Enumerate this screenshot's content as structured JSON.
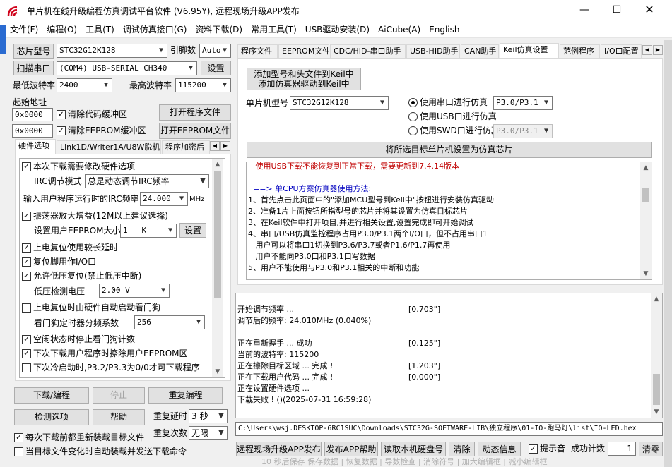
{
  "window": {
    "title": "单片机在线升级编程仿真调试平台软件 (V6.95Y), 远程现场升级APP发布"
  },
  "menu": [
    "文件(F)",
    "编程(O)",
    "工具(T)",
    "调试仿真接口(G)",
    "资料下载(D)",
    "常用工具(T)",
    "USB驱动安装(D)",
    "AiCube(A)",
    "English"
  ],
  "left": {
    "chip_btn": "芯片型号",
    "chip_value": "STC32G12K128",
    "pin_label": "引脚数",
    "pin_value": "Auto",
    "scan_btn": "扫描串口",
    "port_value": "(COM4) USB-SERIAL CH340",
    "settings_btn": "设置",
    "min_baud_label": "最低波特率",
    "min_baud": "2400",
    "max_baud_label": "最高波特率",
    "max_baud": "115200",
    "start_addr_label": "起始地址",
    "code_addr": "0x0000",
    "clear_code": "清除代码缓冲区",
    "open_prog_btn": "打开程序文件",
    "eeprom_addr": "0x0000",
    "clear_eeprom": "清除EEPROM缓冲区",
    "open_eeprom_btn": "打开EEPROM文件",
    "tabs": [
      "硬件选项",
      "Link1D/Writer1A/U8W脱机",
      "程序加密后"
    ],
    "hw": {
      "modify_hw": "本次下载需要修改硬件选项",
      "irc_mode_label": "IRC调节模式",
      "irc_mode": "总是动态调节IRC频率",
      "irc_freq_label": "输入用户程序运行时的IRC频率",
      "irc_freq": "24.000",
      "mhz": "MHz",
      "osc_gain": "振荡器放大增益(12M以上建议选择)",
      "eeprom_size_label": "设置用户EEPROM大小",
      "eeprom_size": "1   K",
      "eeprom_set_btn": "设置",
      "por_delay": "上电复位使用较长延时",
      "reset_io": "复位脚用作I/O口",
      "lvr": "允许低压复位(禁止低压中断)",
      "lvd_label": "低压检测电压",
      "lvd": "2.00 V",
      "wdt_auto": "上电复位时由硬件自动启动看门狗",
      "wdt_div_label": "看门狗定时器分频系数",
      "wdt_div": "256",
      "idle_wdt": "空闲状态时停止看门狗计数",
      "erase_eeprom": "下次下载用户程序时擦除用户EEPROM区",
      "cold_boot": "下次冷启动时,P3.2/P3.3为0/0才可下载程序"
    },
    "download_btn": "下载/编程",
    "stop_btn": "停止",
    "reprog_btn": "重复编程",
    "check_btn": "检测选项",
    "help_btn": "帮助",
    "repeat_delay_label": "重复延时",
    "repeat_delay": "3 秒",
    "repeat_count_label": "重复次数",
    "repeat_count": "无限",
    "reload_each": "每次下载前都重新装载目标文件",
    "auto_send": "当目标文件变化时自动装载并发送下载命令"
  },
  "right": {
    "tabs": [
      "程序文件",
      "EEPROM文件",
      "CDC/HID-串口助手",
      "USB-HID助手",
      "CAN助手",
      "Keil仿真设置",
      "范例程序",
      "I/O口配置"
    ],
    "add_keil_btn_1": "添加型号和头文件到Keil中",
    "add_keil_btn_2": "添加仿真器驱动到Keil中",
    "mcu_label": "单片机型号",
    "mcu_value": "STC32G12K128",
    "radio_serial": "使用串口进行仿真",
    "serial_port": "P3.0/P3.1",
    "radio_usb": "使用USB口进行仿真",
    "radio_swd": "使用SWD口进行仿真",
    "swd_port": "P3.0/P3.1",
    "set_target_btn": "将所选目标单片机设置为仿真芯片",
    "info_lines": [
      {
        "text": "   使用USB下载不能恢复到正常下载，需要更新到7.4.14版本",
        "color": "#c00000"
      },
      {
        "text": "",
        "color": "#000"
      },
      {
        "text": "  ==> 单CPU方案仿真器使用方法:",
        "color": "#0000c0"
      },
      {
        "text": "1、首先点击此页面中的\"添加MCU型号到Keil中\"按钮进行安装仿真驱动",
        "color": "#000"
      },
      {
        "text": "2、准备1片上面按钮所指型号的芯片并将其设置为仿真目标芯片",
        "color": "#000"
      },
      {
        "text": "3、在Keil软件中打开项目,并进行相关设置,设置完成即可开始调试",
        "color": "#000"
      },
      {
        "text": "4、串口/USB仿真监控程序占用P3.0/P3.1两个I/O口，但不占用串口1",
        "color": "#000"
      },
      {
        "text": "   用户可以将串口1切换到P3.6/P3.7或者P1.6/P1.7再使用",
        "color": "#000"
      },
      {
        "text": "   用户不能向P3.0口和P3.1口写数据",
        "color": "#000"
      },
      {
        "text": "5、用户不能使用与P3.0和P3.1相关的中断和功能",
        "color": "#000"
      }
    ],
    "log_lines": [
      {
        "left": "开始调节频率 ...",
        "right": "[0.703\"]"
      },
      {
        "left": "调节后的频率: 24.010MHz (0.040%)",
        "right": ""
      },
      {
        "left": "",
        "right": ""
      },
      {
        "left": "正在重新握手 ... 成功",
        "right": "[0.125\"]"
      },
      {
        "left": "当前的波特率: 115200",
        "right": ""
      },
      {
        "left": "正在擦除目标区域 ... 完成 !",
        "right": "[1.203\"]"
      },
      {
        "left": "正在下载用户代码 ... 完成 !",
        "right": "[0.000\"]"
      },
      {
        "left": "正在设置硬件选项 ...",
        "right": ""
      },
      {
        "left": "下载失败 ! ()(2025-07-31 16:59:28)",
        "right": ""
      }
    ],
    "path": "C:\\Users\\wsj.DESKTOP-6RC1SUC\\Downloads\\STC32G-SOFTWARE-LIB\\独立程序\\01-IO-跑马灯\\list\\IO-LED.hex",
    "bottom": {
      "remote_btn": "远程现场升级APP发布",
      "publish_help_btn": "发布APP帮助",
      "read_disk_btn": "读取本机硬盘号",
      "clear_btn": "清除",
      "anim_btn": "动态信息",
      "beep": "提示音",
      "count_label": "成功计数",
      "count_value": "1",
      "reset_btn": "清零"
    }
  },
  "overlay": {
    "bottom_text": "10 秒后保存  保存数据  |  恢复数据  |  导数检查  |  消除符号  |  加大编辑框  |  减小编辑框"
  }
}
